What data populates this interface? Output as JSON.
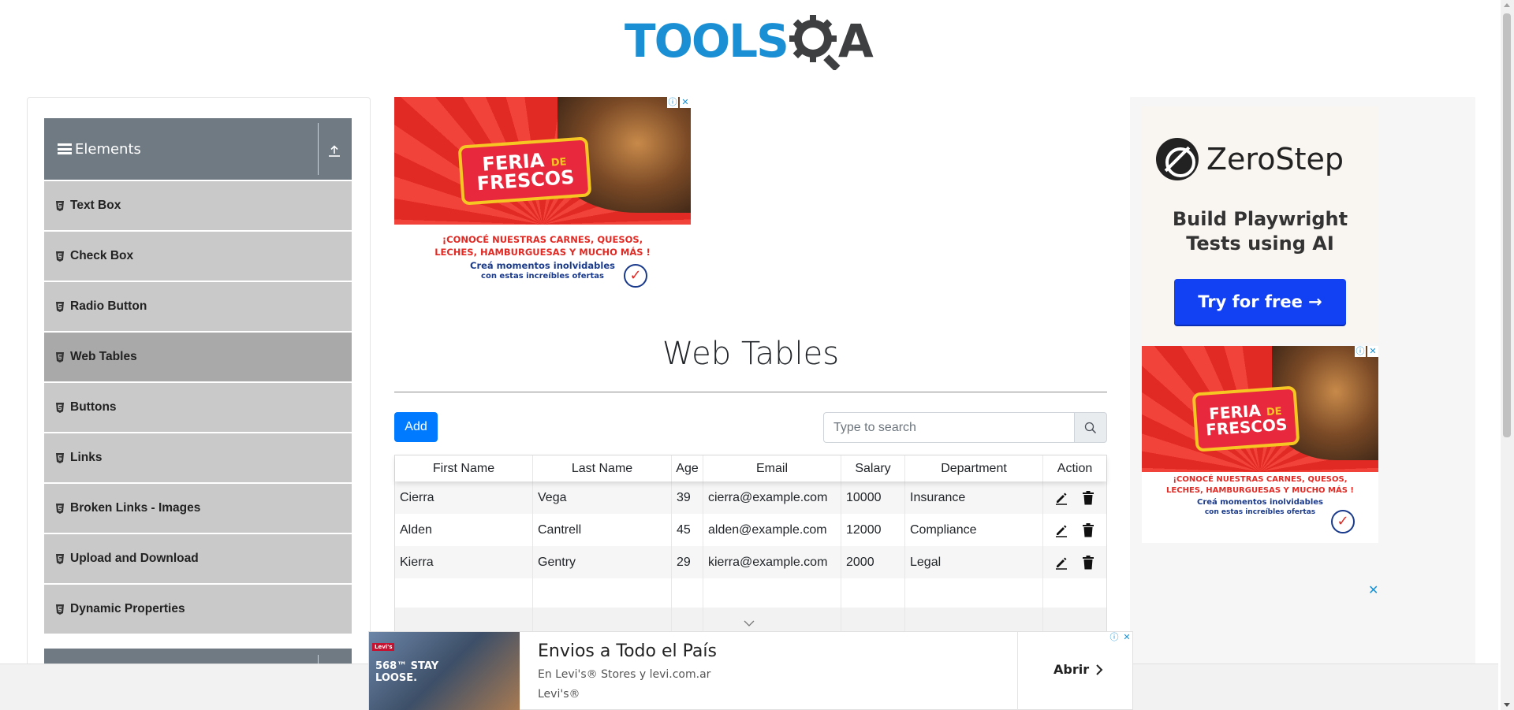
{
  "header": {
    "logo_text": "TOOLS",
    "logo_suffix": "A",
    "logo_icon": "magnifier-gear-icon"
  },
  "sidebar": {
    "group_title": "Elements",
    "group_icon": "hamburger-icon",
    "toggle_icon": "collapse-arrow-icon",
    "items": [
      {
        "label": "Text Box",
        "icon": "html5-icon",
        "active": false
      },
      {
        "label": "Check Box",
        "icon": "html5-icon",
        "active": false
      },
      {
        "label": "Radio Button",
        "icon": "html5-icon",
        "active": false
      },
      {
        "label": "Web Tables",
        "icon": "html5-icon",
        "active": true
      },
      {
        "label": "Buttons",
        "icon": "html5-icon",
        "active": false
      },
      {
        "label": "Links",
        "icon": "html5-icon",
        "active": false
      },
      {
        "label": "Broken Links - Images",
        "icon": "html5-icon",
        "active": false
      },
      {
        "label": "Upload and Download",
        "icon": "html5-icon",
        "active": false
      },
      {
        "label": "Dynamic Properties",
        "icon": "html5-icon",
        "active": false
      }
    ]
  },
  "ads": {
    "feria": {
      "w1": "FERIA",
      "w2": "DE",
      "w3": "FRESCOS",
      "line1": "¡CONOCÉ NUESTRAS CARNES, QUESOS,",
      "line2": "LECHES, HAMBURGUESAS Y MUCHO MÁS !",
      "line3a": "Creá momentos inolvidables",
      "line3b": "con estas increíbles ofertas"
    },
    "zerostep": {
      "name": "ZeroStep",
      "tagline_1": "Build Playwright",
      "tagline_2": "Tests using AI",
      "cta": "Try for free →"
    },
    "bottom": {
      "image_text_1": "568™ STAY",
      "image_text_2": "LOOSE.",
      "brand_tag": "Levi's",
      "headline": "Envios a Todo el País",
      "sub1": "En Levi's® Stores y levi.com.ar",
      "sub2": "Levi's®",
      "cta": "Abrir"
    }
  },
  "main": {
    "title": "Web Tables",
    "add_label": "Add",
    "search_placeholder": "Type to search",
    "search_icon": "search-icon",
    "table": {
      "headers": [
        "First Name",
        "Last Name",
        "Age",
        "Email",
        "Salary",
        "Department",
        "Action"
      ],
      "rows": [
        [
          "Cierra",
          "Vega",
          "39",
          "cierra@example.com",
          "10000",
          "Insurance"
        ],
        [
          "Alden",
          "Cantrell",
          "45",
          "alden@example.com",
          "12000",
          "Compliance"
        ],
        [
          "Kierra",
          "Gentry",
          "29",
          "kierra@example.com",
          "2000",
          "Legal"
        ]
      ],
      "action_icons": [
        "edit-icon",
        "delete-icon"
      ]
    }
  },
  "colors": {
    "accent": "#007bff",
    "logo_blue": "#1a8fd4",
    "sidebar_header": "#707a83",
    "menu_item": "#c9c9c9",
    "menu_item_active": "#a9a9a9",
    "zerostep_cta": "#1141f2"
  }
}
